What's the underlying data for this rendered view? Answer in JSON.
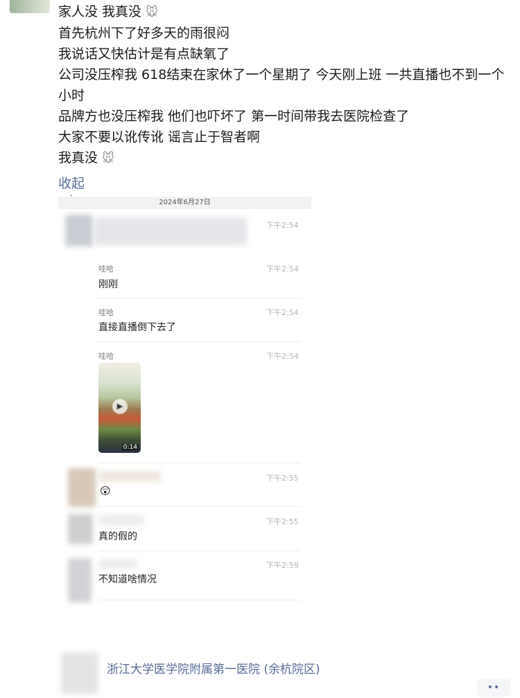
{
  "post": {
    "lines": [
      "家人没 我真没",
      "首先杭州下了好多天的雨很闷",
      "我说话又快估计是有点缺氧了",
      "公司没压榨我 618结束在家休了一个星期了 今天刚上班 一共直播也不到一个小时",
      "品牌方也没压榨我 他们也吓坏了 第一时间带我去医院检查了",
      "大家不要以讹传讹 谣言止于智者啊",
      "我真没"
    ],
    "emoji_icon": "mouse-face-icon",
    "collapse_label": "收起"
  },
  "chat": {
    "date": "2024年6月27日",
    "messages": [
      {
        "sender": "",
        "time": "下午2:54",
        "text": ""
      },
      {
        "sender": "哇哈",
        "time": "下午2:54",
        "text": "刚刚"
      },
      {
        "sender": "哇哈",
        "time": "下午2:54",
        "text": "直接直播倒下去了"
      },
      {
        "sender": "哇哈",
        "time": "下午2:54",
        "text": "",
        "video_duration": "0:14"
      },
      {
        "sender": "",
        "time": "下午2:55",
        "text": "",
        "emoji_icon": "astonished-face-icon"
      },
      {
        "sender": "",
        "time": "下午2:55",
        "text": "真的假的"
      },
      {
        "sender": "",
        "time": "下午2:59",
        "text": "不知道啥情况"
      }
    ]
  },
  "location": "浙江大学医学院附属第一医院 (余杭院区)",
  "more_button": "••",
  "colors": {
    "link": "#576b95",
    "time": "#b5b5b5"
  }
}
